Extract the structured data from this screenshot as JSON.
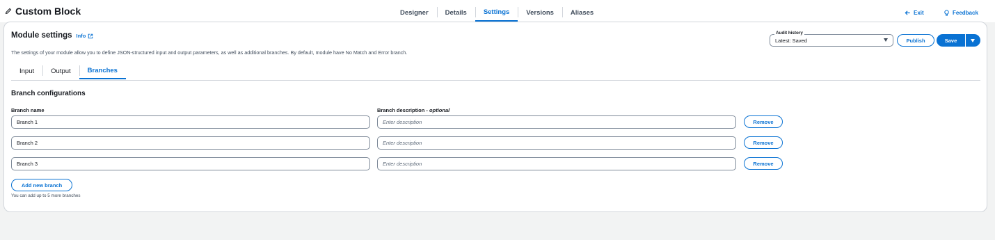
{
  "header": {
    "title": "Custom Block",
    "tabs": [
      "Designer",
      "Details",
      "Settings",
      "Versions",
      "Aliases"
    ],
    "active_tab": "Settings",
    "exit_label": "Exit",
    "feedback_label": "Feedback"
  },
  "card": {
    "title": "Module settings",
    "info_label": "Info",
    "description": "The settings of your module allow you to define JSON-structured input and output parameters, as well as additional branches. By default, module have No Match and Error branch.",
    "audit": {
      "label": "Audit history",
      "value": "Latest: Saved"
    },
    "publish_label": "Publish",
    "save_label": "Save",
    "subtabs": [
      "Input",
      "Output",
      "Branches"
    ],
    "active_subtab": "Branches"
  },
  "branches": {
    "section_title": "Branch configurations",
    "name_label": "Branch name",
    "desc_label": "Branch description -",
    "desc_optional": "optional",
    "desc_placeholder": "Enter description",
    "remove_label": "Remove",
    "rows": [
      {
        "name": "Branch 1",
        "description": ""
      },
      {
        "name": "Branch 2",
        "description": ""
      },
      {
        "name": "Branch 3",
        "description": ""
      }
    ],
    "add_label": "Add new branch",
    "hint": "You can add up to 5 more branches"
  },
  "colors": {
    "accent": "#0972d3",
    "text": "#16191f",
    "border": "#7d8998",
    "background": "#f2f3f3"
  }
}
